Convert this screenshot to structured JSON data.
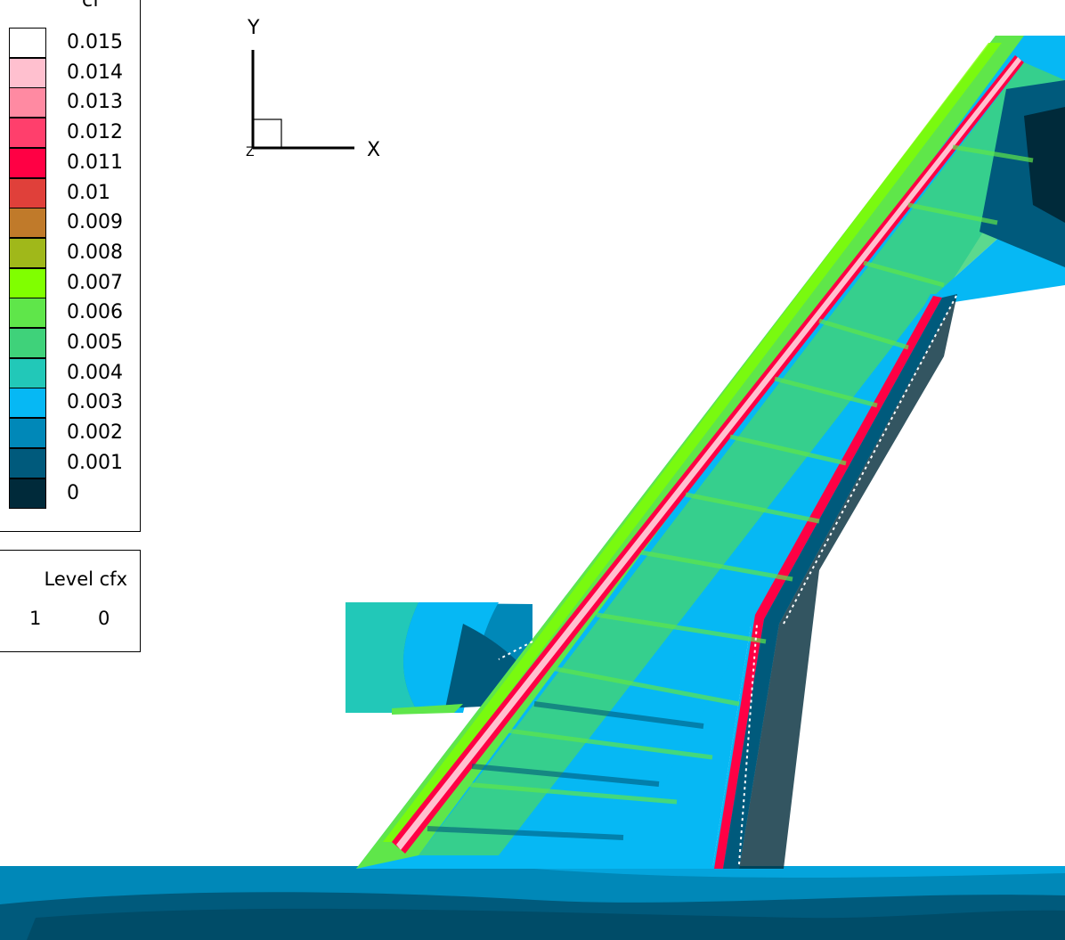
{
  "legend": {
    "title": "cf",
    "levels": [
      {
        "label": "0.015",
        "color": "#ffffff"
      },
      {
        "label": "0.014",
        "color": "#ffc0cf"
      },
      {
        "label": "0.013",
        "color": "#ff8aa2"
      },
      {
        "label": "0.012",
        "color": "#ff3f6c"
      },
      {
        "label": "0.011",
        "color": "#ff0044"
      },
      {
        "label": "0.01",
        "color": "#e0403a"
      },
      {
        "label": "0.009",
        "color": "#c07a2a"
      },
      {
        "label": "0.008",
        "color": "#a0b81a"
      },
      {
        "label": "0.007",
        "color": "#80ff00"
      },
      {
        "label": "0.006",
        "color": "#5fe64a"
      },
      {
        "label": "0.005",
        "color": "#3fd27a"
      },
      {
        "label": "0.004",
        "color": "#22c8b8"
      },
      {
        "label": "0.003",
        "color": "#06b8f4"
      },
      {
        "label": "0.002",
        "color": "#0088b8"
      },
      {
        "label": "0.001",
        "color": "#005a7c"
      },
      {
        "label": "0",
        "color": "#002a3a"
      }
    ]
  },
  "contour_table": {
    "header": "Level cfx",
    "level": "1",
    "value": "0"
  },
  "axes_triad": {
    "x_label": "X",
    "y_label": "Y",
    "z_label": "Z"
  }
}
